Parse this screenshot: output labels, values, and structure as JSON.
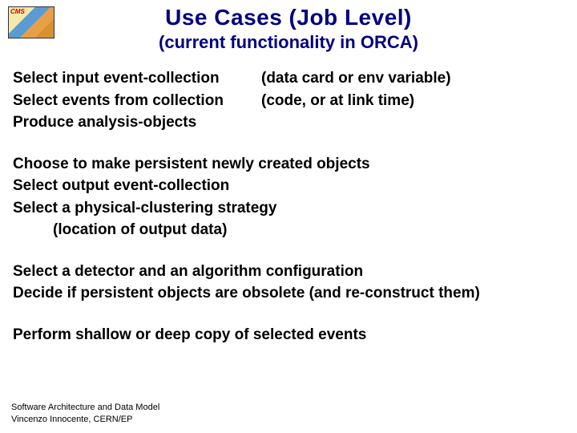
{
  "logo": {
    "label": "CMS"
  },
  "header": {
    "title": "Use Cases (Job Level)",
    "subtitle": "(current functionality in ORCA)"
  },
  "block1": {
    "r1_left": "Select input event-collection",
    "r1_right": "(data card or env variable)",
    "r2_left": "Select events from collection",
    "r2_right": "(code, or at link time)",
    "r3_left": "Produce analysis-objects"
  },
  "block2": {
    "l1": "Choose to make persistent newly created objects",
    "l2": "Select output event-collection",
    "l3": "Select a physical-clustering strategy",
    "l4": "(location of output data)"
  },
  "block3": {
    "l1": "Select a detector and an algorithm configuration",
    "l2": "Decide if persistent objects are obsolete (and re-construct them)"
  },
  "block4": {
    "l1": "Perform shallow or deep copy of selected events"
  },
  "footer": {
    "l1": "Software Architecture and Data Model",
    "l2": "Vincenzo Innocente, CERN/EP"
  }
}
